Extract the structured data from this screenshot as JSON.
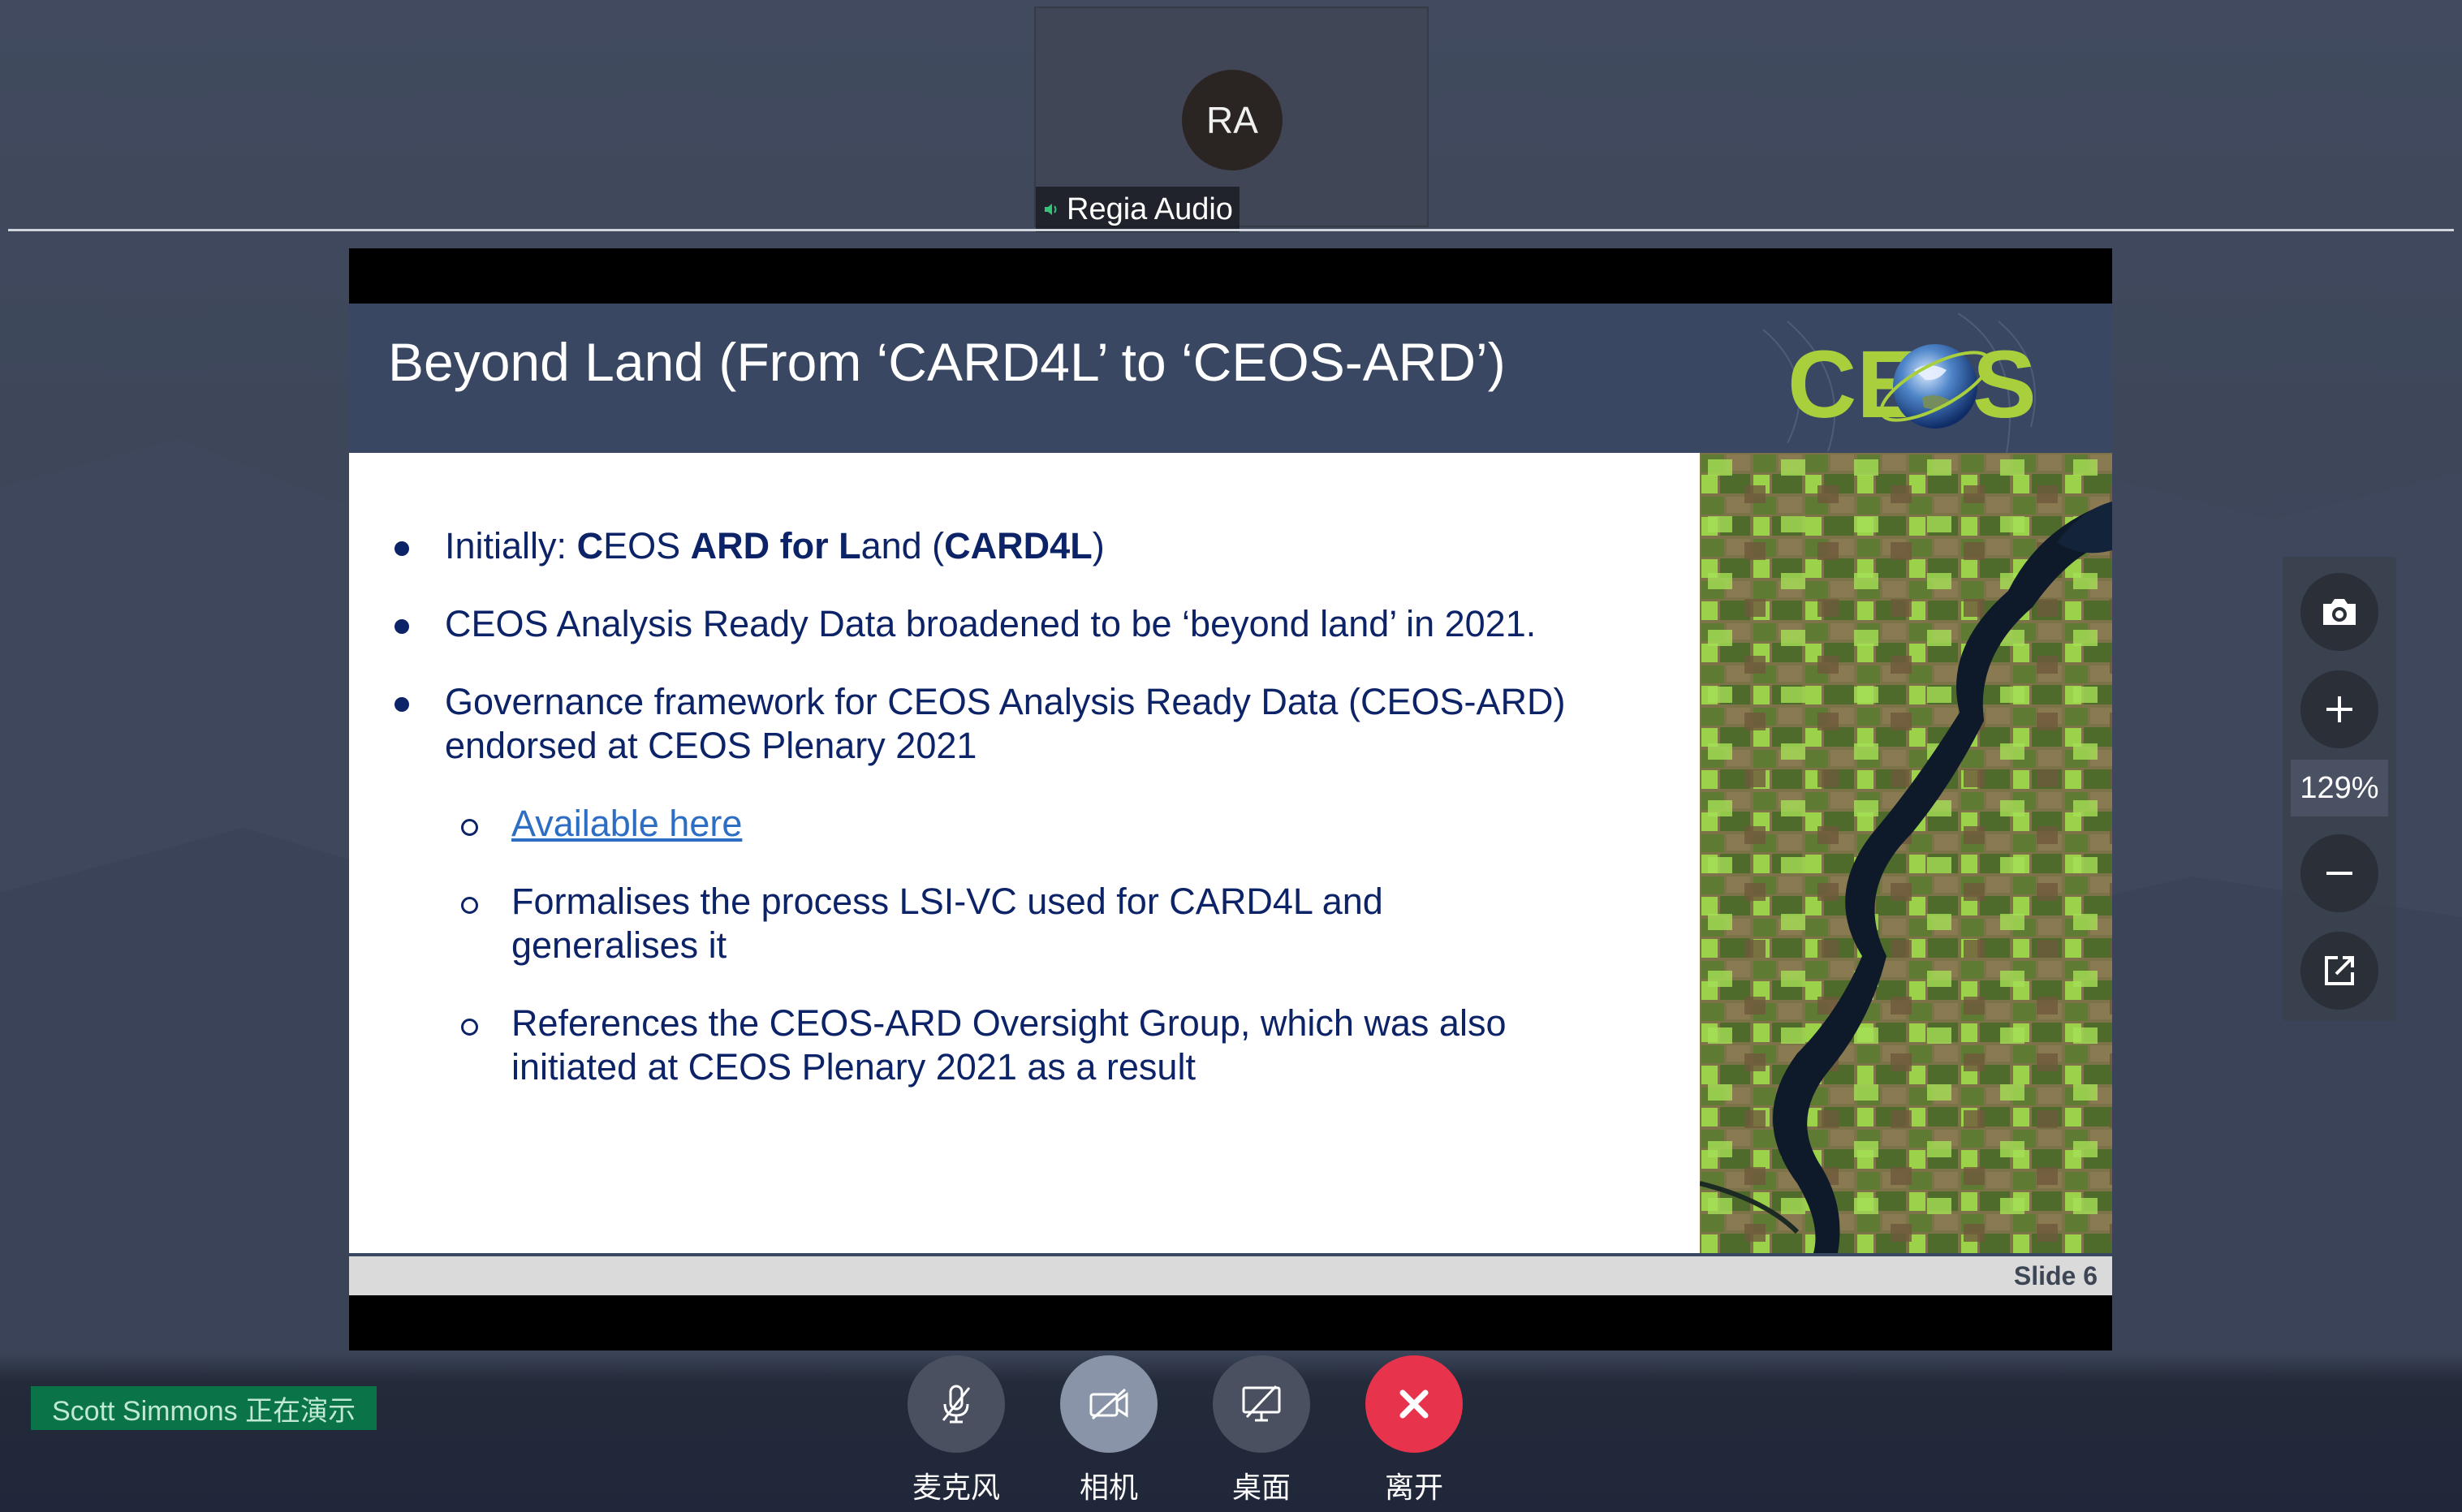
{
  "participant": {
    "initials": "RA",
    "name": "Regia Audio",
    "icon": "speaker-icon"
  },
  "slide": {
    "title": "Beyond Land (From ‘CARD4L’ to ‘CEOS-ARD’)",
    "logo_text": "CEOS",
    "bullets": {
      "b1": {
        "pre": "Initially: ",
        "c": "C",
        "eos": "EOS ",
        "ard": "ARD for L",
        "and": "and (",
        "card4l": "CARD4L",
        "close": ")"
      },
      "b2": "CEOS Analysis Ready Data broadened to be ‘beyond land’ in 2021.",
      "b3": "Governance framework for CEOS Analysis Ready Data (CEOS-ARD) endorsed at CEOS Plenary 2021"
    },
    "sub_bullets": {
      "s1": "Available here",
      "s2": "Formalises the process LSI-VC used for CARD4L and generalises it",
      "s3": "References the CEOS-ARD Oversight Group, which was also initiated at CEOS Plenary 2021 as a result"
    },
    "footer": "Slide 6"
  },
  "zoom": {
    "level": "129%",
    "icons": [
      "camera-icon",
      "zoom-in-icon",
      "zoom-out-icon",
      "open-external-icon"
    ]
  },
  "presenter": "Scott  Simmons 正在演示",
  "controls": {
    "mic": "麦克风",
    "camera": "相机",
    "desktop": "桌面",
    "leave": "离开"
  },
  "colors": {
    "slide_header": "#3a4762",
    "slide_text": "#0d2367",
    "link": "#2d6ec3",
    "presenter_badge": "#0a7348",
    "leave_button": "#e8334d"
  }
}
